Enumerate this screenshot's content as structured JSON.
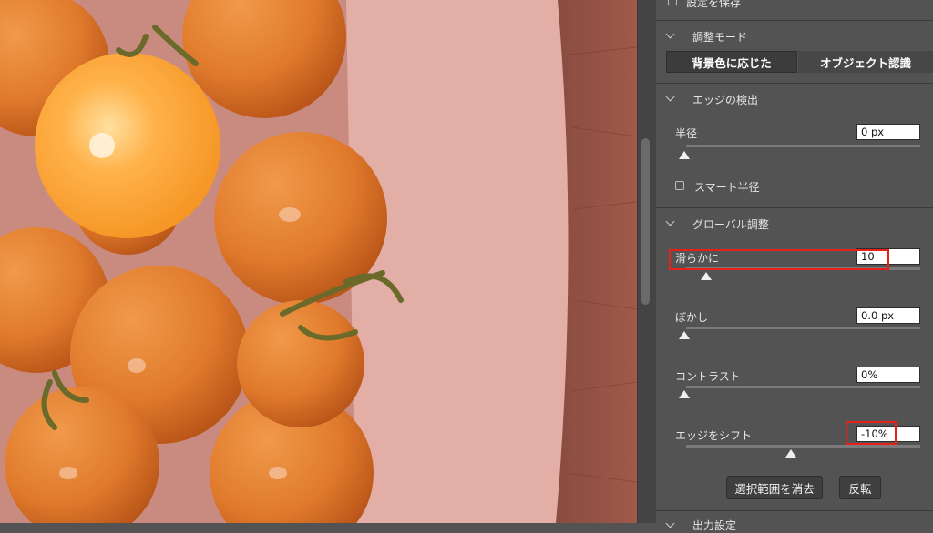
{
  "panel": {
    "save_settings_label": "設定を保存",
    "adjust_mode": {
      "title": "調整モード",
      "options": [
        "背景色に応じた",
        "オブジェクト認識"
      ],
      "selected": "背景色に応じた"
    },
    "edge_detection": {
      "title": "エッジの検出",
      "radius_label": "半径",
      "radius_value": "0 px",
      "radius_level": 0,
      "smart_radius_label": "スマート半径",
      "smart_radius_checked": false
    },
    "global_refinements": {
      "title": "グローバル調整",
      "smooth_label": "滑らかに",
      "smooth_value": "10",
      "smooth_level": 0.1,
      "feather_label": "ぼかし",
      "feather_value": "0.0 px",
      "feather_level": 0,
      "contrast_label": "コントラスト",
      "contrast_value": "0%",
      "contrast_level": 0,
      "shift_edge_label": "エッジをシフト",
      "shift_edge_value": "-10%",
      "shift_edge_level": 0.45
    },
    "clear_selection_label": "選択範囲を消去",
    "invert_label": "反転",
    "output_settings_title": "出力設定"
  },
  "colors": {
    "panel_bg": "#535353",
    "highlight": "#e8201a",
    "overlay": "#d88a7e"
  },
  "icons": {
    "checkbox": "checkbox-icon",
    "chevron": "chevron-down-icon",
    "slider_thumb": "slider-thumb-icon"
  }
}
